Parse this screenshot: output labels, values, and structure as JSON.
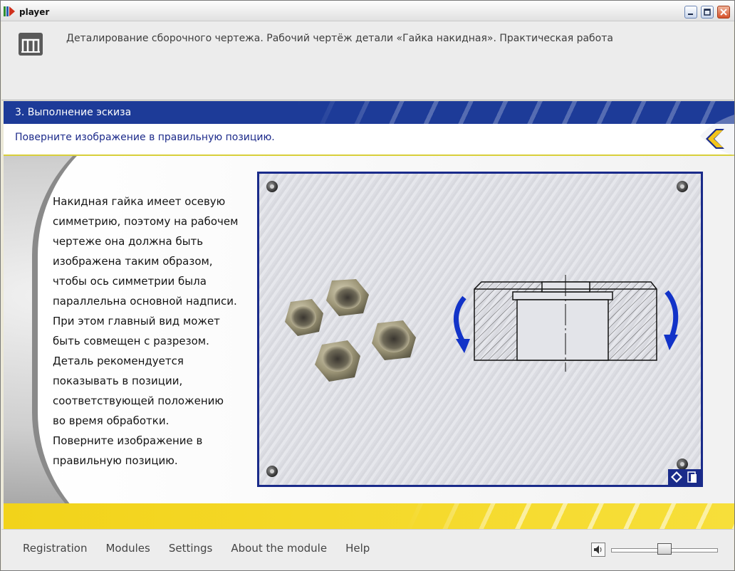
{
  "window": {
    "title": "player"
  },
  "header": {
    "course_title": "Деталирование сборочного чертежа. Рабочий чертёж детали «Гайка накидная». Практическая работа"
  },
  "section": {
    "title": "3. Выполнение эскиза"
  },
  "instruction": "Поверните изображение в правильную позицию.",
  "description_lines": [
    "Накидная гайка имеет осевую",
    "симметрию, поэтому на рабочем",
    "чертеже она должна быть",
    "изображена таким образом,",
    "чтобы ось симметрии была",
    "параллельна основной надписи.",
    "При этом главный вид может",
    "быть совмещен с разрезом.",
    "Деталь рекомендуется",
    "показывать в позиции,",
    "соответствующей положению",
    "во время обработки.",
    "Поверните изображение в",
    "правильную позицию."
  ],
  "footer": {
    "menu": [
      "Registration",
      "Modules",
      "Settings",
      "About the module",
      "Help"
    ],
    "volume": 0.5
  },
  "colors": {
    "accent_blue": "#1d3b98",
    "accent_yellow": "#f2d31a",
    "rotate_arrow": "#1233c8"
  },
  "icons": [
    "app-icon",
    "minimize-icon",
    "maximize-icon",
    "close-icon",
    "logo-icon",
    "back-arrow-icon",
    "rotate-left-icon",
    "rotate-right-icon",
    "eraser-icon",
    "copy-icon",
    "sound-icon"
  ]
}
